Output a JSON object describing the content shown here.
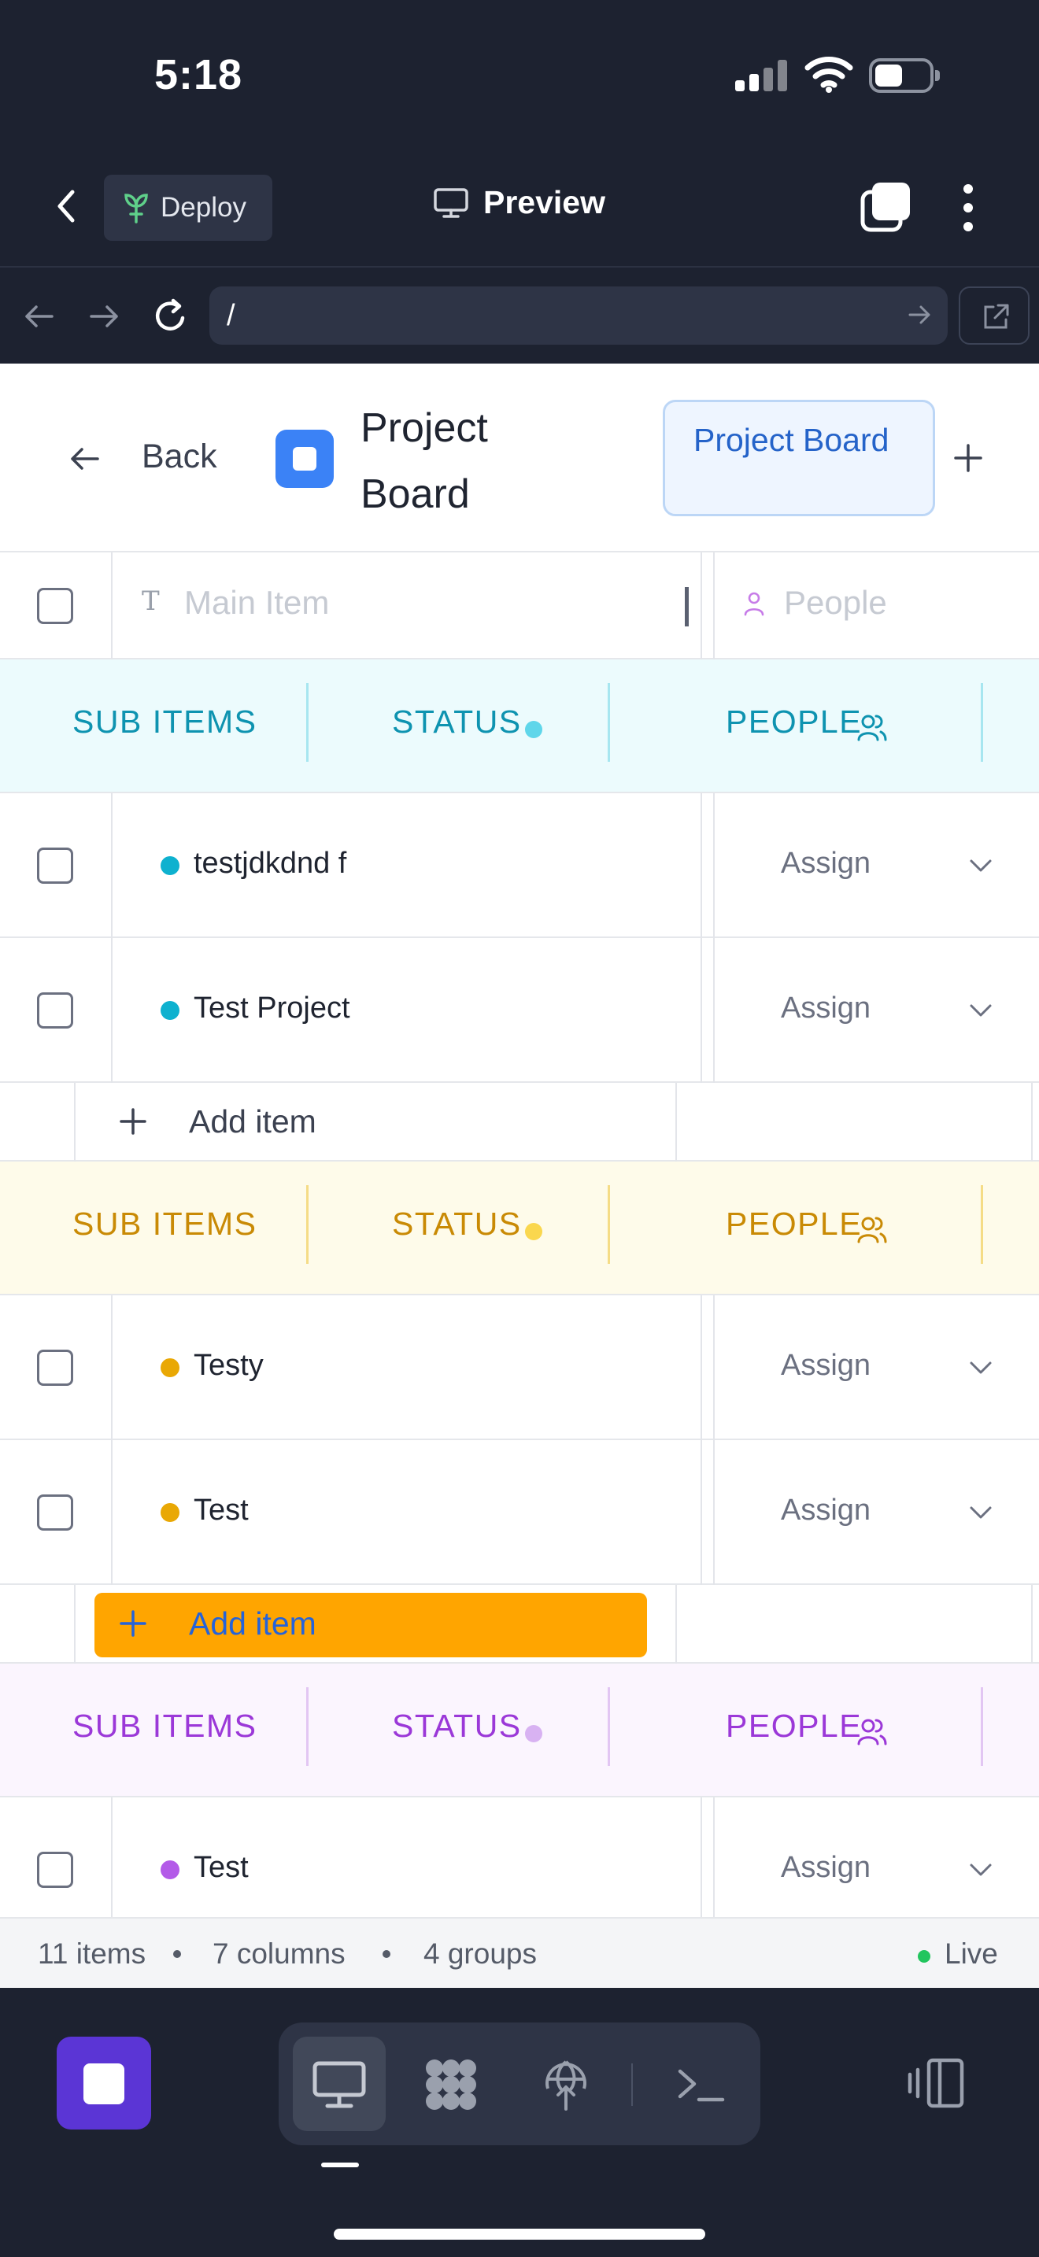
{
  "status_bar": {
    "time": "5:18"
  },
  "header": {
    "deploy_label": "Deploy",
    "preview_label": "Preview"
  },
  "browser": {
    "url": "/"
  },
  "page": {
    "back_label": "Back",
    "title": "Project Board",
    "active_tab": "Project Board"
  },
  "columns": {
    "main_item_placeholder": "Main Item",
    "people_placeholder": "People"
  },
  "groups": [
    {
      "color": "#0e93b0",
      "bg": "#ecfbfd",
      "divider": "#a7e6f0",
      "status_dot": "#5fd6ea",
      "item_dot": "#0eb1cf",
      "headers": {
        "sub_items": "SUB ITEMS",
        "status": "STATUS",
        "people": "PEOPLE"
      },
      "rows": [
        {
          "name": "testjdkdnd f",
          "people": "Assign"
        },
        {
          "name": "Test Project",
          "people": "Assign"
        }
      ],
      "add_label": "Add item"
    },
    {
      "color": "#c98a05",
      "bg": "#fefbea",
      "divider": "#f5dc86",
      "status_dot": "#fad74e",
      "item_dot": "#e9a805",
      "headers": {
        "sub_items": "SUB ITEMS",
        "status": "STATUS",
        "people": "PEOPLE"
      },
      "rows": [
        {
          "name": "Testy",
          "people": "Assign"
        },
        {
          "name": "Test",
          "people": "Assign"
        }
      ],
      "add_label": "Add item"
    },
    {
      "color": "#9b38d8",
      "bg": "#fbf5fe",
      "divider": "#e2c6f3",
      "status_dot": "#d8b2f2",
      "item_dot": "#b35ae8",
      "headers": {
        "sub_items": "SUB ITEMS",
        "status": "STATUS",
        "people": "PEOPLE"
      },
      "rows": [
        {
          "name": "Test",
          "people": "Assign"
        }
      ]
    }
  ],
  "footer": {
    "items": "11 items",
    "columns": "7 columns",
    "groups": "4 groups",
    "live": "Live"
  },
  "icons": {
    "header": [
      "chevron-left-icon",
      "sprout-icon",
      "monitor-icon",
      "tabs-icon",
      "more-vertical-icon"
    ],
    "browser": [
      "arrow-left-icon",
      "arrow-right-icon",
      "refresh-icon",
      "arrow-right-small-icon",
      "external-link-icon"
    ],
    "dock": [
      "app-square-icon",
      "monitor-icon",
      "grid-blob-icon",
      "globe-upload-icon",
      "terminal-icon",
      "panel-toggle-icon"
    ]
  },
  "colors": {
    "chrome_bg": "#1d2230",
    "accent_blue": "#3b82f6",
    "dock_app": "#5b35d5",
    "highlight_orange": "#ffa500",
    "live_green": "#22c55e"
  }
}
